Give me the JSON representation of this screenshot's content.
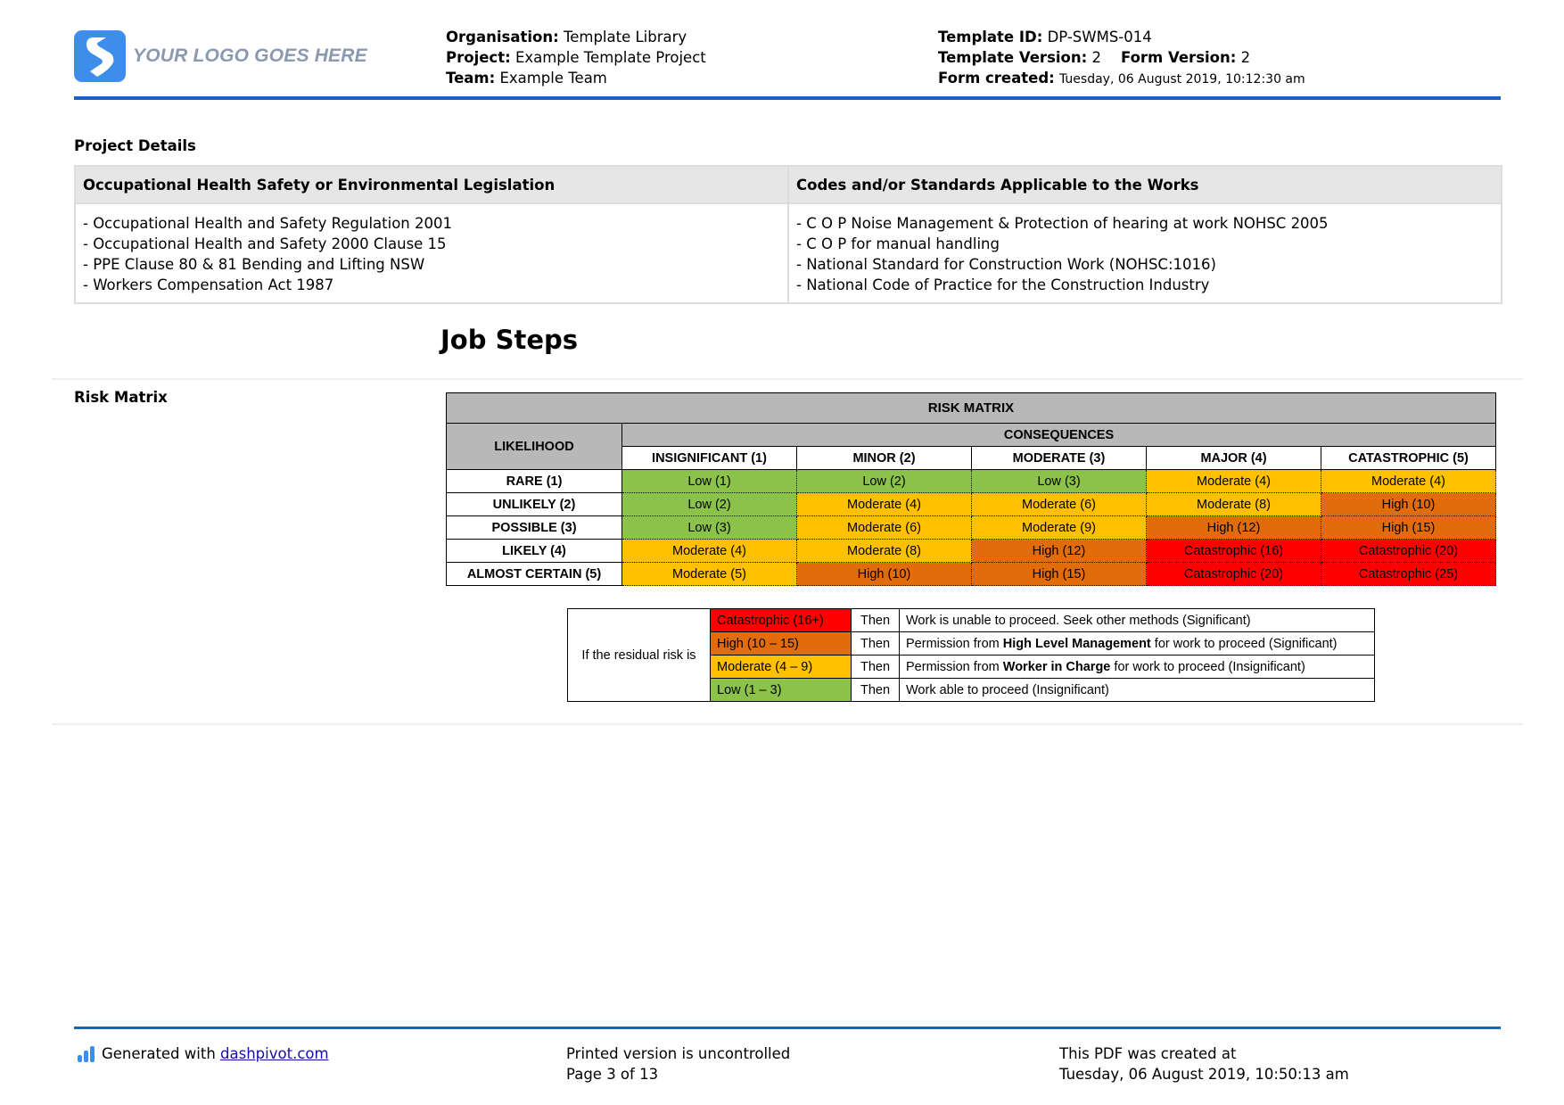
{
  "header": {
    "logo_text": "YOUR LOGO GOES HERE",
    "organisation_label": "Organisation:",
    "organisation_value": " Template Library",
    "project_label": "Project:",
    "project_value": "Example Template Project",
    "team_label": "Team:",
    "team_value": "Example Team",
    "template_id_label": "Template ID:",
    "template_id_value": "DP-SWMS-014",
    "template_version_label": "Template Version:",
    "template_version_value": "2",
    "form_version_label": "Form Version:",
    "form_version_value": "2",
    "form_created_label": "Form created:",
    "form_created_value": "Tuesday, 06 August 2019, 10:12:30 am"
  },
  "project_details": {
    "label": "Project Details",
    "col1_header": "Occupational Health Safety or Environmental Legislation",
    "col2_header": "Codes and/or Standards Applicable to the Works",
    "col1_items": [
      "- Occupational Health and Safety Regulation 2001",
      "- Occupational Health and Safety 2000 Clause 15",
      "- PPE Clause 80 & 81 Bending and Lifting NSW",
      "- Workers Compensation Act 1987"
    ],
    "col2_items": [
      "- C O P Noise Management & Protection of hearing at work NOHSC 2005",
      "- C O P for manual handling",
      "- National Standard for Construction Work (NOHSC:1016)",
      "- National Code of Practice for the Construction Industry"
    ]
  },
  "job_steps_title": "Job Steps",
  "risk_matrix": {
    "label": "Risk Matrix",
    "title": "RISK MATRIX",
    "likelihood_header": "LIKELIHOOD",
    "consequences_header": "CONSEQUENCES",
    "consequences": [
      "INSIGNIFICANT (1)",
      "MINOR (2)",
      "MODERATE (3)",
      "MAJOR (4)",
      "CATASTROPHIC (5)"
    ],
    "rows": [
      {
        "likelihood": "RARE (1)",
        "cells": [
          "Low (1)",
          "Low (2)",
          "Low (3)",
          "Moderate (4)",
          "Moderate (4)"
        ],
        "levels": [
          "low",
          "low",
          "low",
          "mod",
          "mod"
        ]
      },
      {
        "likelihood": "UNLIKELY (2)",
        "cells": [
          "Low (2)",
          "Moderate (4)",
          "Moderate (6)",
          "Moderate (8)",
          "High (10)"
        ],
        "levels": [
          "low",
          "mod",
          "mod",
          "mod",
          "high"
        ]
      },
      {
        "likelihood": "POSSIBLE (3)",
        "cells": [
          "Low (3)",
          "Moderate (6)",
          "Moderate (9)",
          "High (12)",
          "High (15)"
        ],
        "levels": [
          "low",
          "mod",
          "mod",
          "high",
          "high"
        ]
      },
      {
        "likelihood": "LIKELY (4)",
        "cells": [
          "Moderate (4)",
          "Moderate (8)",
          "High (12)",
          "Catastrophic (16)",
          "Catastrophic (20)"
        ],
        "levels": [
          "mod",
          "mod",
          "high",
          "cat",
          "cat"
        ]
      },
      {
        "likelihood": "ALMOST CERTAIN (5)",
        "cells": [
          "Moderate (5)",
          "High (10)",
          "High (15)",
          "Catastrophic (20)",
          "Catastrophic (25)"
        ],
        "levels": [
          "mod",
          "high",
          "high",
          "cat",
          "cat"
        ]
      }
    ],
    "colors": {
      "low": "#8bc34a",
      "mod": "#ffc000",
      "high": "#e26b0a",
      "cat": "#ff0000"
    }
  },
  "legend": {
    "lead": "If the residual risk is",
    "then": "Then",
    "rows": [
      {
        "level": "Catastrophic (16+)",
        "pre": "Work is unable to proceed. Seek other methods (Significant)",
        "bold": "",
        "post": ""
      },
      {
        "level": "High (10 – 15)",
        "pre": "Permission from ",
        "bold": "High Level Management",
        "post": " for work to proceed (Significant)"
      },
      {
        "level": "Moderate (4 – 9)",
        "pre": "Permission from ",
        "bold": "Worker in Charge",
        "post": " for work to proceed (Insignificant)"
      },
      {
        "level": "Low (1 – 3)",
        "pre": "Work able to proceed (Insignificant)",
        "bold": "",
        "post": ""
      }
    ]
  },
  "footer": {
    "generated_with": "Generated with ",
    "link_text": "dashpivot.com",
    "printed_line1": "Printed version is uncontrolled",
    "printed_line2": "Page 3 of 13",
    "created_line1": "This PDF was created at",
    "created_line2": "Tuesday, 06 August 2019, 10:50:13 am"
  }
}
